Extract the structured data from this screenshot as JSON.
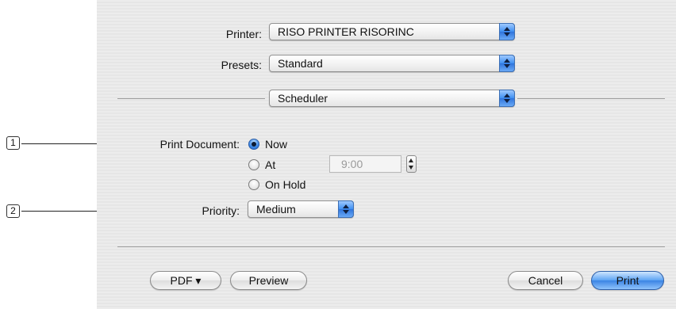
{
  "printer": {
    "label": "Printer:",
    "value": "RISO PRINTER RISORINC"
  },
  "presets": {
    "label": "Presets:",
    "value": "Standard"
  },
  "panel": {
    "value": "Scheduler"
  },
  "print_document": {
    "label": "Print Document:",
    "options": [
      {
        "label": "Now",
        "selected": true
      },
      {
        "label": "At",
        "selected": false
      },
      {
        "label": "On Hold",
        "selected": false
      }
    ],
    "time_value": "9:00"
  },
  "priority": {
    "label": "Priority:",
    "value": "Medium"
  },
  "callouts": [
    "1",
    "2"
  ],
  "buttons": {
    "pdf": "PDF ▾",
    "preview": "Preview",
    "cancel": "Cancel",
    "print": "Print"
  },
  "colors": {
    "accent": "#3b84e4",
    "dialog_bg": "#e9e9e9"
  }
}
